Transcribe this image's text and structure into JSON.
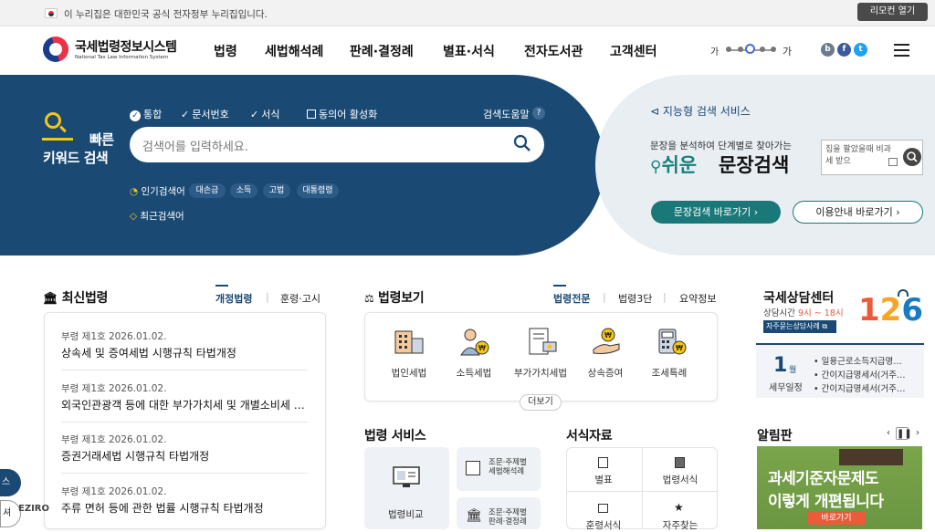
{
  "gov_banner": {
    "text": "이 누리집은 대한민국 공식 전자정부 누리집입니다.",
    "remote_label": "리모컨 열기"
  },
  "header": {
    "logo_kr": "국세법령정보시스템",
    "logo_en": "National Tax Law Information System",
    "nav": [
      "법령",
      "세법해석례",
      "판례·결정례",
      "별표·서식",
      "전자도서관",
      "고객센터"
    ],
    "font_small": "가",
    "font_large": "가",
    "social": [
      "blog-icon",
      "facebook-icon",
      "twitter-icon"
    ]
  },
  "quick_search": {
    "title_line1": "빠른",
    "title_line2": "키워드 검색",
    "options": [
      "통합",
      "문서번호",
      "서식",
      "동의어 활성화"
    ],
    "help_label": "검색도움말",
    "placeholder": "검색어를 입력하세요.",
    "popular_label": "인기검색어",
    "popular_tags": [
      "대손금",
      "소득",
      "고법",
      "대통령령"
    ],
    "recent_label": "최근검색어"
  },
  "ai_search": {
    "heading": "지능형 검색 서비스",
    "sub": "문장을 분석하여 단계별로 찾아가는",
    "easy": "쉬운",
    "big": "문장검색",
    "demo_text": "집을 팔았을때 비과세 받으",
    "btn_go": "문장검색 바로가기",
    "btn_guide": "이용안내 바로가기"
  },
  "latest_laws": {
    "title": "최신법령",
    "tabs": [
      "개정법령",
      "훈령·고시"
    ],
    "items": [
      {
        "meta": "부령 제1호    2026.01.02.",
        "title": "상속세 및 증여세법 시행규칙 타법개정"
      },
      {
        "meta": "부령 제1호    2026.01.02.",
        "title": "외국인관광객 등에 대한 부가가치세 및 개별소비세 …"
      },
      {
        "meta": "부령 제1호    2026.01.02.",
        "title": "증권거래세법 시행규칙 타법개정"
      },
      {
        "meta": "부령 제1호    2026.01.02.",
        "title": "주류 면허 등에 관한 법률 시행규칙 타법개정"
      }
    ]
  },
  "law_view": {
    "title": "법령보기",
    "tabs": [
      "법령전문",
      "법령3단",
      "요약정보"
    ],
    "items": [
      "법인세법",
      "소득세법",
      "부가가치세법",
      "상속증여",
      "조세특례"
    ],
    "more": "더보기"
  },
  "law_service": {
    "title": "법령 서비스",
    "main_label": "법령비교",
    "cards": [
      "조문·주제별\n세법해석례",
      "조문·주제별\n판례·결정례"
    ]
  },
  "forms": {
    "title": "서식자료",
    "cells": [
      "별표",
      "법령서식",
      "훈령서식",
      "자주찾는"
    ]
  },
  "consult": {
    "title": "국세상담센터",
    "hours_label": "상담시간",
    "hours": "9시 ~ 18시",
    "faq": "자주묻는상담사례",
    "number": "126"
  },
  "tax_schedule": {
    "month": "1",
    "month_unit": "월",
    "label": "세무일정",
    "items": [
      "일용근로소득지급명…",
      "간이지급명세서(거주…",
      "간이지급명세서(거주…"
    ]
  },
  "notice": {
    "title": "알림판",
    "banner_line1": "과세기준자문제도",
    "banner_line2": "이렇게 개편됩니다",
    "banner_btn": "바로가기"
  },
  "floating": {
    "a": "스",
    "b": "셔",
    "c": "EZIRO"
  },
  "colors": {
    "navy": "#1a4a74",
    "teal": "#1b7878",
    "accent_yellow": "#f5c518"
  }
}
